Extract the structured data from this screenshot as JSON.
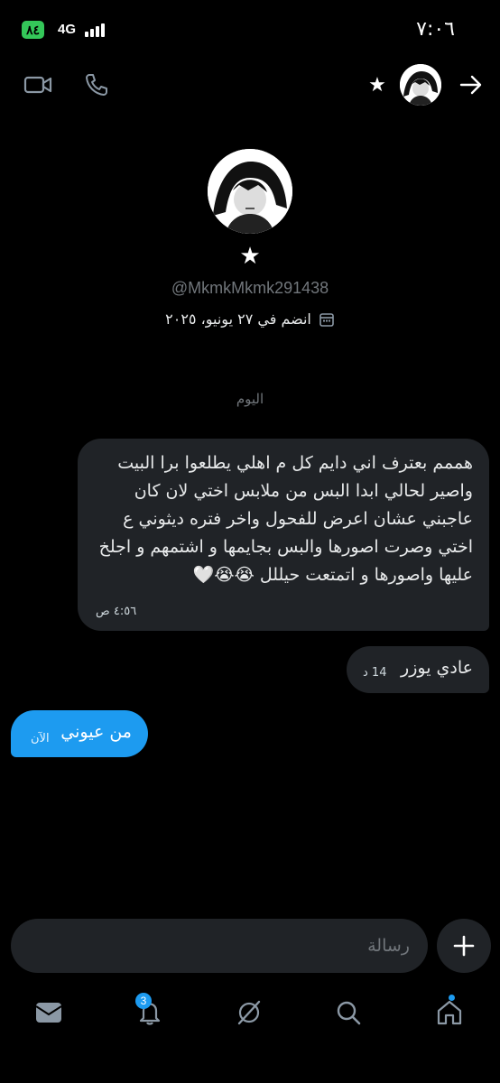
{
  "status_bar": {
    "time": "٧:٠٦",
    "battery": "٨٤",
    "network": "4G"
  },
  "header": {
    "star": "★"
  },
  "profile": {
    "star": "★",
    "handle": "@MkmkMkmk291438",
    "joined": "انضم في ٢٧ يونيو، ٢٠٢٥"
  },
  "day_divider": "اليوم",
  "messages": [
    {
      "text": "هممم بعترف اني دايم كل م اهلي يطلعوا برا البيت واصير لحالي ابدا البس من ملابس اختي لان كان عاجبني عشان اعرض للفحول واخر فتره ديثوني ع اختي وصرت اصورها والبس بجايمها و اشتمهم و اجلخ عليها واصورها و اتمتعت حيللل 😭😭🤍",
      "time": "٤:٥٦ ص"
    },
    {
      "text": "عادي يوزر",
      "time": "14 د"
    },
    {
      "text": "من عيوني",
      "time": "الآن"
    }
  ],
  "composer": {
    "placeholder": "رسالة"
  },
  "nav": {
    "notifications_badge": "3"
  },
  "colors": {
    "accent": "#1d9bf0",
    "incoming_bubble": "#202327",
    "muted_text": "#71767b",
    "battery": "#34c759"
  }
}
